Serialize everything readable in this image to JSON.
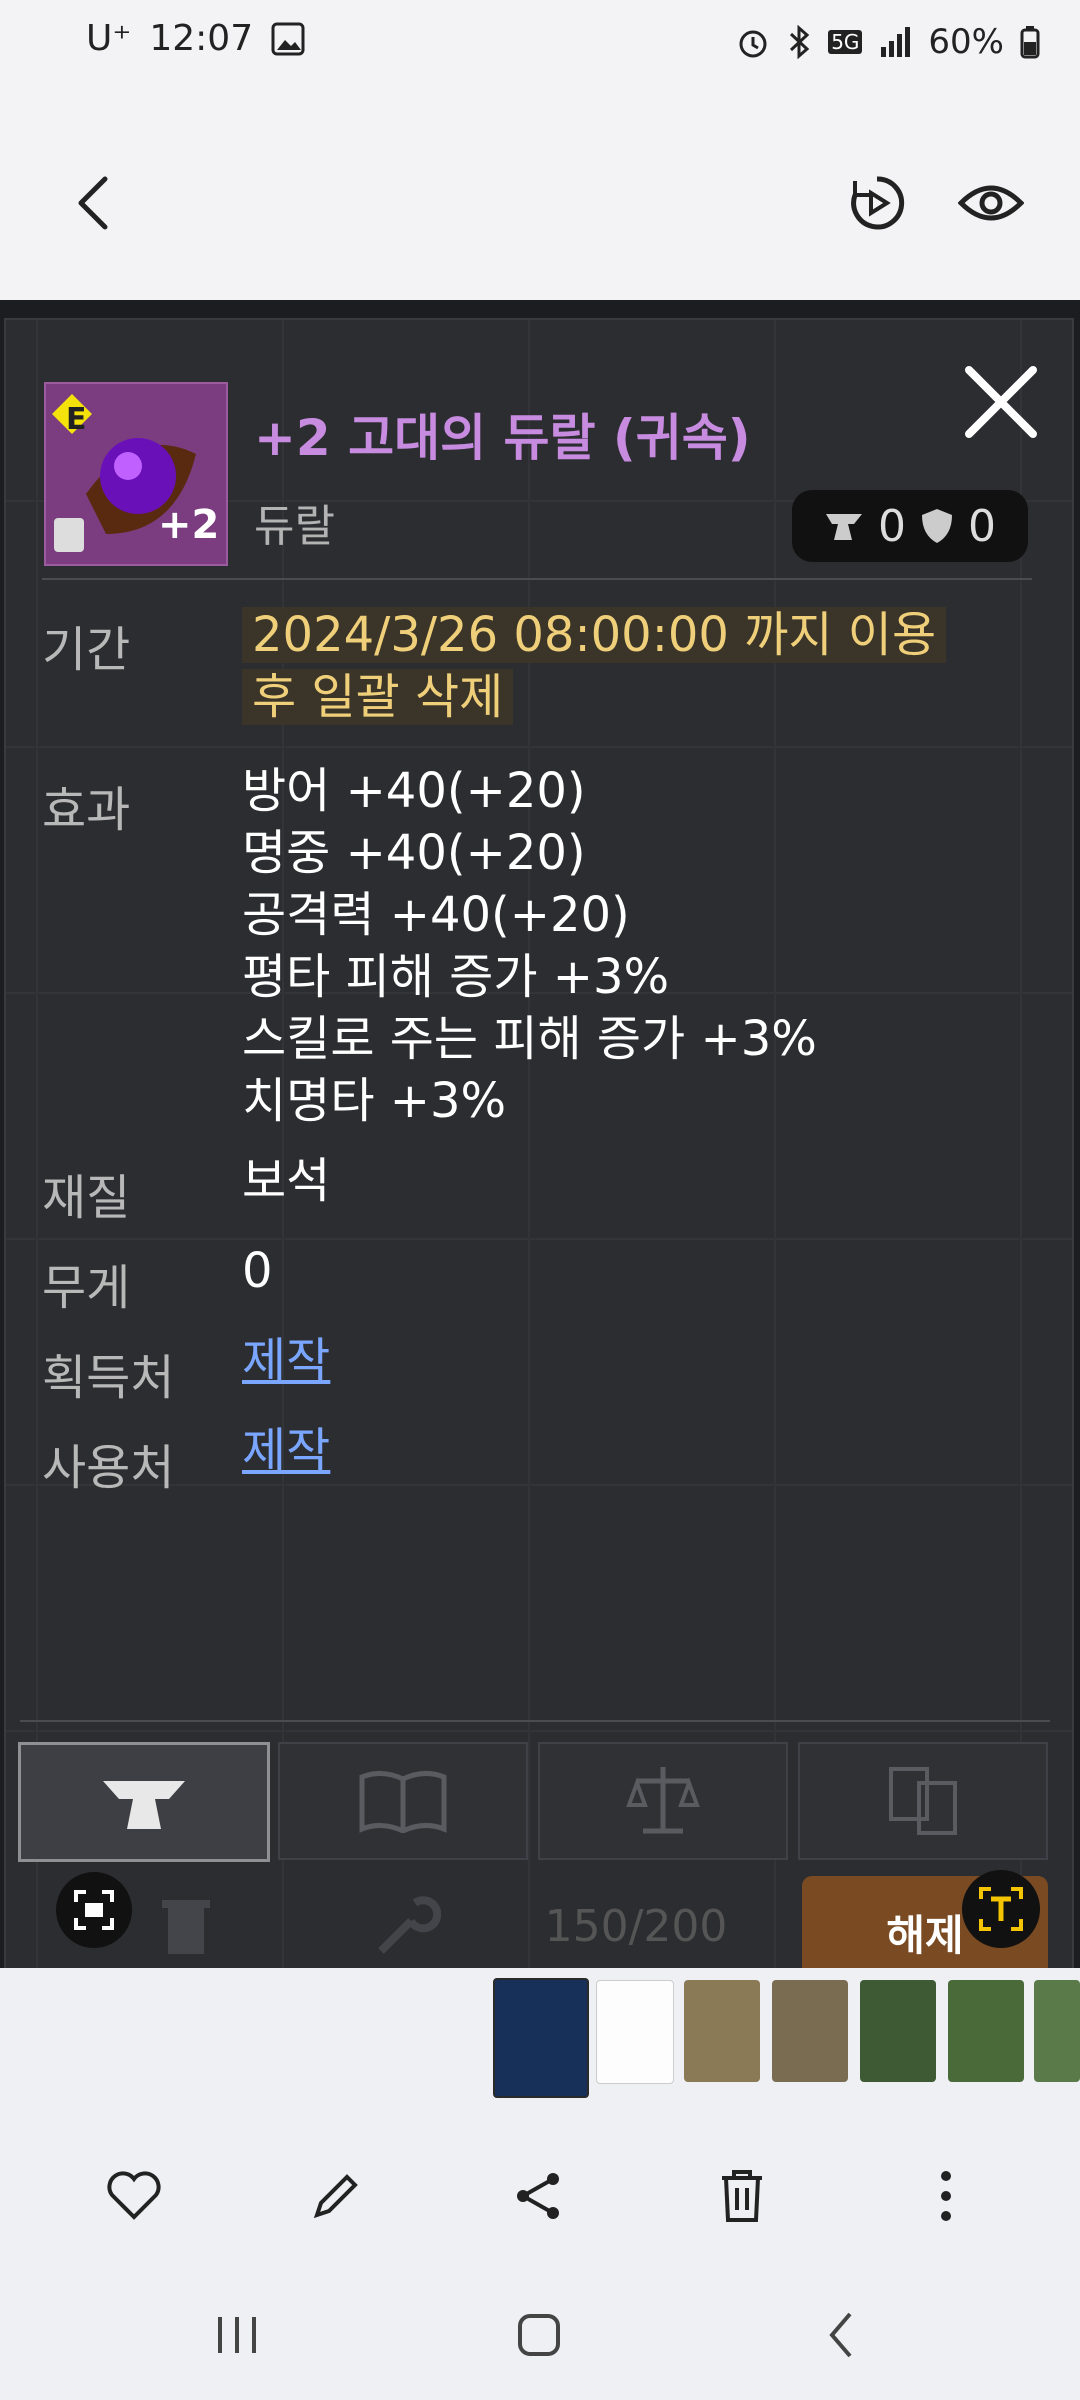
{
  "status_bar": {
    "carrier": "U⁺",
    "time": "12:07",
    "network": "5G",
    "battery": "60%"
  },
  "item": {
    "title": "+2 고대의 듀랄 (귀속)",
    "subtitle": "듀랄",
    "grade_badge": "E",
    "enhance_label": "+2",
    "stat_anvil": "0",
    "stat_shield": "0"
  },
  "details": {
    "period_label": "기간",
    "period_value_line1": "2024/3/26 08:00:00 까지 이용",
    "period_value_line2": "후 일괄 삭제",
    "effect_label": "효과",
    "effects": [
      "방어 +40(+20)",
      "명중 +40(+20)",
      "공격력 +40(+20)",
      "평타 피해 증가 +3%",
      "스킬로 주는 피해 증가 +3%",
      "치명타 +3%"
    ],
    "material_label": "재질",
    "material_value": "보석",
    "weight_label": "무게",
    "weight_value": "0",
    "source_label": "획득처",
    "source_value": "제작",
    "usage_label": "사용처",
    "usage_value": "제작"
  },
  "footer": {
    "capacity": "150/200",
    "release_button": "해제"
  },
  "icons": {
    "back": "chevron-left-icon",
    "remaster": "remaster-icon",
    "view": "eye-icon"
  }
}
